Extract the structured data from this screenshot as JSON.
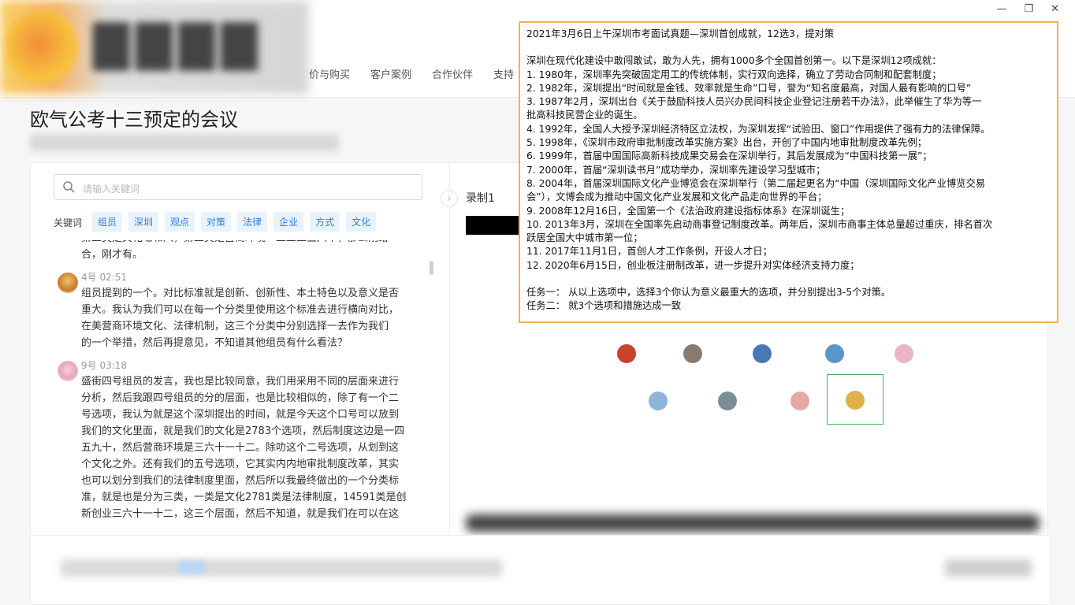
{
  "header": {
    "nav": [
      "价与购买",
      "客户案例",
      "合作伙伴",
      "支持"
    ],
    "window_controls": {
      "min": "—",
      "max": "❐",
      "close": "✕"
    }
  },
  "page": {
    "title": "欧气公考十三预定的会议"
  },
  "left": {
    "search_placeholder": "请输入关键词",
    "keyword_label": "关键词",
    "keywords": [
      "组员",
      "深圳",
      "观点",
      "对策",
      "法律",
      "企业",
      "方式",
      "文化"
    ],
    "partial_top": "第二类是文化七和八，第三类是营商环境一二二二五六十，那么刚给",
    "partial_top2": "合，刚才有。",
    "messages": [
      {
        "speaker": "4号 02:51",
        "lines": [
          "组员提到的一个。对比标准就是创新、创新性、本土特色以及意义是否",
          "重大。我认为我们可以在每一个分类里使用这个标准去进行横向对比，",
          "在美营商环境文化、法律机制，这三个分类中分别选择一去作为我们",
          "的一个举措，然后再提意见，不知道其他组员有什么看法？"
        ]
      },
      {
        "speaker": "9号 03:18",
        "lines": [
          "盛街四号组员的发言，我也是比较同意，我们用采用不同的层面来进行",
          "分析，然后我跟四号组员的分的层面，也是比较相似的，除了有一个二",
          "号选项，我认为就是这个深圳提出的时间，就是今天这个口号可以放到",
          "我们的文化里面，就是我们的文化是2783个选项，然后制度这边是一四",
          "五九十，然后营商环境是三六十一十二。除叻这个二号选项，从划到这",
          "个文化之外。还有我们的五号选项，它其实内内地审批制度改革，其实",
          "也可以划分到我们的法律制度里面，然后所以我最终做出的一个分类标",
          "准，就是也是分为三类，一类是文化2781类是法律制度，14591类是创",
          "新创业三六十一十二，这三个层面，然后不知道，就是我们在可以在这"
        ]
      }
    ]
  },
  "right": {
    "recording_label": "录制1"
  },
  "overlay": {
    "lines": [
      "2021年3月6日上午深圳市考面试真题—深圳首创成就，12选3，提对策",
      "",
      "深圳在现代化建设中敢闯敢试，敢为人先，拥有1000多个全国首创第一。以下是深圳12项成就：",
      "1. 1980年，深圳率先突破固定用工的传统体制，实行双向选择，确立了劳动合同制和配套制度；",
      "2. 1982年，深圳提出“时间就是金钱、效率就是生命”口号，誉为“知名度最高，对国人最有影响的口号”",
      "3. 1987年2月，深圳出台《关于鼓励科技人员兴办民间科技企业登记注册若干办法》，此举催生了华为等一",
      "批高科技民营企业的诞生。",
      "4. 1992年，全国人大授予深圳经济特区立法权，为深圳发挥“试验田、窗口”作用提供了强有力的法律保障。",
      "5. 1998年，《深圳市政府审批制度改革实施方案》出台，开创了中国内地审批制度改革先例；",
      "6. 1999年，首届中国国际高新科技成果交易会在深圳举行，其后发展成为“中国科技第一展”；",
      "7. 2000年，首届“深圳读书月”成功举办，深圳率先建设学习型城市；",
      "8. 2004年，首届深圳国际文化产业博览会在深圳举行（第二届起更名为“中国（深圳国际文化产业博览交易",
      "会”），文博会成为推动中国文化产业发展和文化产品走向世界的平台；",
      "9. 2008年12月16日，全国第一个《法治政府建设指标体系》在深圳诞生；",
      "10. 2013年3月，深圳在全国率先启动商事登记制度改革。两年后，深圳市商事主体总量超过重庆，排名首次",
      "跃居全国大中城市第一位；",
      "11. 2017年11月1日，首创人才工作条例，开设人才日；",
      "12. 2020年6月15日，创业板注册制改革，进一步提升对实体经济支持力度；",
      "",
      "任务一：   从以上选项中，选择3个你认为意义最重大的选项，并分别提出3-5个对策。",
      "任务二：   就3个选项和措施达成一致"
    ]
  },
  "colors": {
    "accent": "#2f7fd8",
    "overlay_border": "#f4b24d",
    "selected_border": "#4caf50"
  }
}
